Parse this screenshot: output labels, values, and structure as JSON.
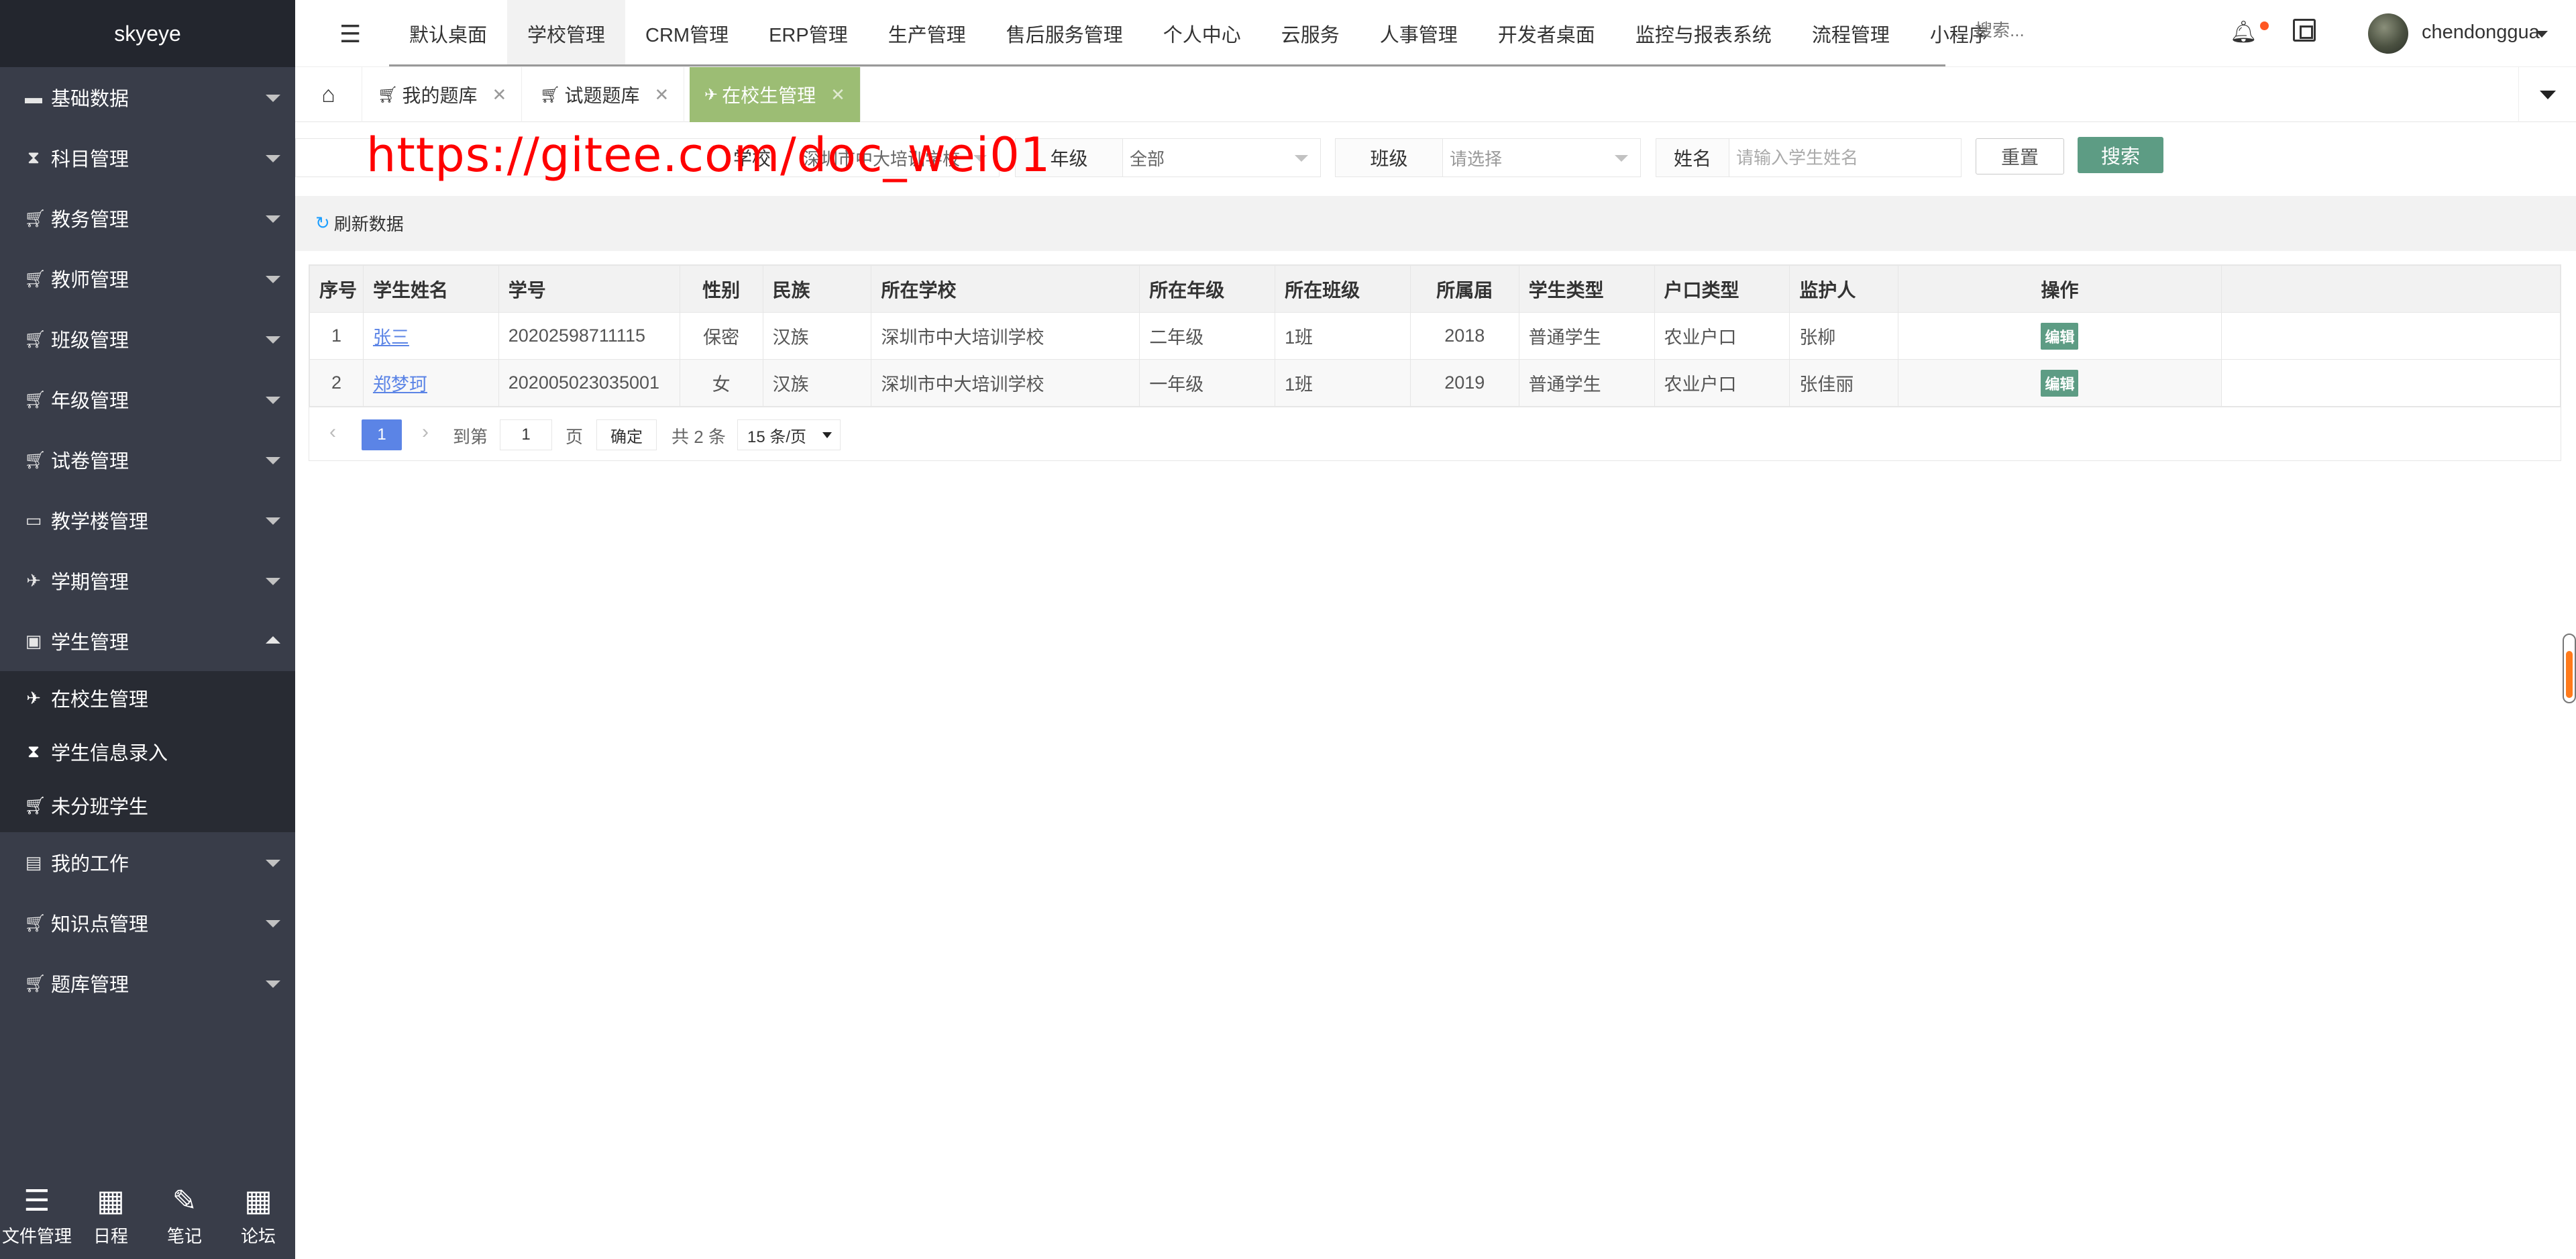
{
  "brand": "skyeye",
  "sidebar": {
    "items": [
      {
        "label": "基础数据",
        "icon": "folder-icon"
      },
      {
        "label": "科目管理",
        "icon": "hourglass-icon"
      },
      {
        "label": "教务管理",
        "icon": "cart-icon"
      },
      {
        "label": "教师管理",
        "icon": "cart-icon"
      },
      {
        "label": "班级管理",
        "icon": "cart-icon"
      },
      {
        "label": "年级管理",
        "icon": "cart-icon"
      },
      {
        "label": "试卷管理",
        "icon": "cart-icon"
      },
      {
        "label": "教学楼管理",
        "icon": "folder-open-icon"
      },
      {
        "label": "学期管理",
        "icon": "paper-plane-icon"
      },
      {
        "label": "学生管理",
        "icon": "id-card-icon"
      }
    ],
    "sub_items": [
      {
        "label": "在校生管理",
        "icon": "paper-plane-icon"
      },
      {
        "label": "学生信息录入",
        "icon": "hourglass-icon"
      },
      {
        "label": "未分班学生",
        "icon": "cart-icon"
      }
    ],
    "items_after": [
      {
        "label": "我的工作",
        "icon": "archive-icon"
      },
      {
        "label": "知识点管理",
        "icon": "cart-icon"
      },
      {
        "label": "题库管理",
        "icon": "cart-icon"
      }
    ],
    "bottom": [
      {
        "label": "文件管理",
        "icon": "list-icon"
      },
      {
        "label": "日程",
        "icon": "calendar-icon"
      },
      {
        "label": "笔记",
        "icon": "edit-icon"
      },
      {
        "label": "论坛",
        "icon": "calendar-icon"
      }
    ]
  },
  "topbar": {
    "nav": [
      "默认桌面",
      "学校管理",
      "CRM管理",
      "ERP管理",
      "生产管理",
      "售后服务管理",
      "个人中心",
      "云服务",
      "人事管理",
      "开发者桌面",
      "监控与报表系统",
      "流程管理",
      "小程序"
    ],
    "active_nav": "学校管理",
    "search_placeholder": "搜索...",
    "username": "chendonggua"
  },
  "tabs": [
    {
      "label": "我的题库",
      "icon": "cart-icon"
    },
    {
      "label": "试题题库",
      "icon": "cart-icon"
    },
    {
      "label": "在校生管理",
      "icon": "paper-plane-icon",
      "active": true
    }
  ],
  "filters": {
    "school_label": "学校",
    "school_value": "深圳市中大培训学校",
    "grade_label": "年级",
    "grade_value": "全部",
    "class_label": "班级",
    "class_placeholder": "请选择",
    "name_label": "姓名",
    "name_placeholder": "请输入学生姓名",
    "reset_label": "重置",
    "search_label": "搜索"
  },
  "watermark": "https://gitee.com/doc_wei01",
  "toolbar": {
    "refresh_label": "刷新数据"
  },
  "table": {
    "headers": [
      "序号",
      "学生姓名",
      "学号",
      "性别",
      "民族",
      "所在学校",
      "所在年级",
      "所在班级",
      "所属届",
      "学生类型",
      "户口类型",
      "监护人",
      "操作"
    ],
    "rows": [
      [
        "1",
        "张三",
        "20202598711115",
        "保密",
        "汉族",
        "深圳市中大培训学校",
        "二年级",
        "1班",
        "2018",
        "普通学生",
        "农业户口",
        "张柳",
        "编辑"
      ],
      [
        "2",
        "郑梦珂",
        "202005023035001",
        "女",
        "汉族",
        "深圳市中大培训学校",
        "一年级",
        "1班",
        "2019",
        "普通学生",
        "农业户口",
        "张佳丽",
        "编辑"
      ]
    ]
  },
  "pager": {
    "current": "1",
    "goto_prefix": "到第",
    "goto_value": "1",
    "goto_suffix": "页",
    "confirm": "确定",
    "total": "共 2 条",
    "page_size": "15 条/页"
  },
  "colors": {
    "sidebar_bg": "#393d49",
    "accent_green": "#5d9c84",
    "active_tab": "#9cbd74",
    "link_blue": "#5b84e6",
    "watermark_red": "#ff0000"
  }
}
